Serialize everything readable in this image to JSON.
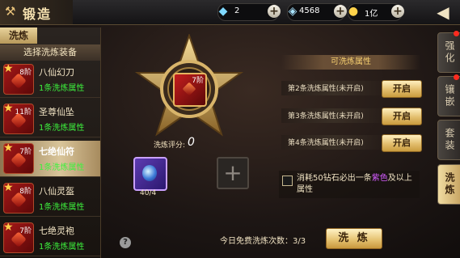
{
  "header": {
    "title": "锻造",
    "resources": [
      {
        "icon": "diamond-icon",
        "value": "2"
      },
      {
        "icon": "bound-diamond-icon",
        "value": "4568"
      },
      {
        "icon": "gold-coin-icon",
        "value": "1亿"
      }
    ],
    "back_icon": "back-arrow-icon"
  },
  "left_panel": {
    "tab_label": "洗炼",
    "subheader": "选择洗炼装备",
    "items": [
      {
        "name": "八仙幻刀",
        "level": "8阶",
        "attr": "1条洗炼属性",
        "selected": false
      },
      {
        "name": "圣尊仙坠",
        "level": "11阶",
        "attr": "1条洗炼属性",
        "selected": false
      },
      {
        "name": "七绝仙符",
        "level": "7阶",
        "attr": "1条洗炼属性",
        "selected": true
      },
      {
        "name": "八仙灵盔",
        "level": "8阶",
        "attr": "1条洗炼属性",
        "selected": false
      },
      {
        "name": "七绝灵袍",
        "level": "7阶",
        "attr": "1条洗炼属性",
        "selected": false
      }
    ]
  },
  "center": {
    "slot_level": "7阶",
    "score_label": "洗炼评分:",
    "score_value": "0",
    "stone_count": "40/4"
  },
  "attributes": {
    "header": "可洗炼属性",
    "rows": [
      {
        "label": "第2条洗炼属性(未开启)",
        "button": "开启"
      },
      {
        "label": "第3条洗炼属性(未开启)",
        "button": "开启"
      },
      {
        "label": "第4条洗炼属性(未开启)",
        "button": "开启"
      }
    ]
  },
  "consume": {
    "text_before": "消耗50钻石必出一条",
    "highlight": "紫色",
    "text_after": "及以上属性",
    "highlight_color": "#d45cff"
  },
  "footer": {
    "free_count_text": "今日免费洗炼次数：3/3",
    "action_button": "洗 炼"
  },
  "side_tabs": [
    {
      "label": "强化",
      "active": false,
      "badge": true
    },
    {
      "label": "镶嵌",
      "active": false,
      "badge": true
    },
    {
      "label": "套装",
      "active": false,
      "badge": false
    },
    {
      "label": "洗炼",
      "active": true,
      "badge": false
    }
  ]
}
